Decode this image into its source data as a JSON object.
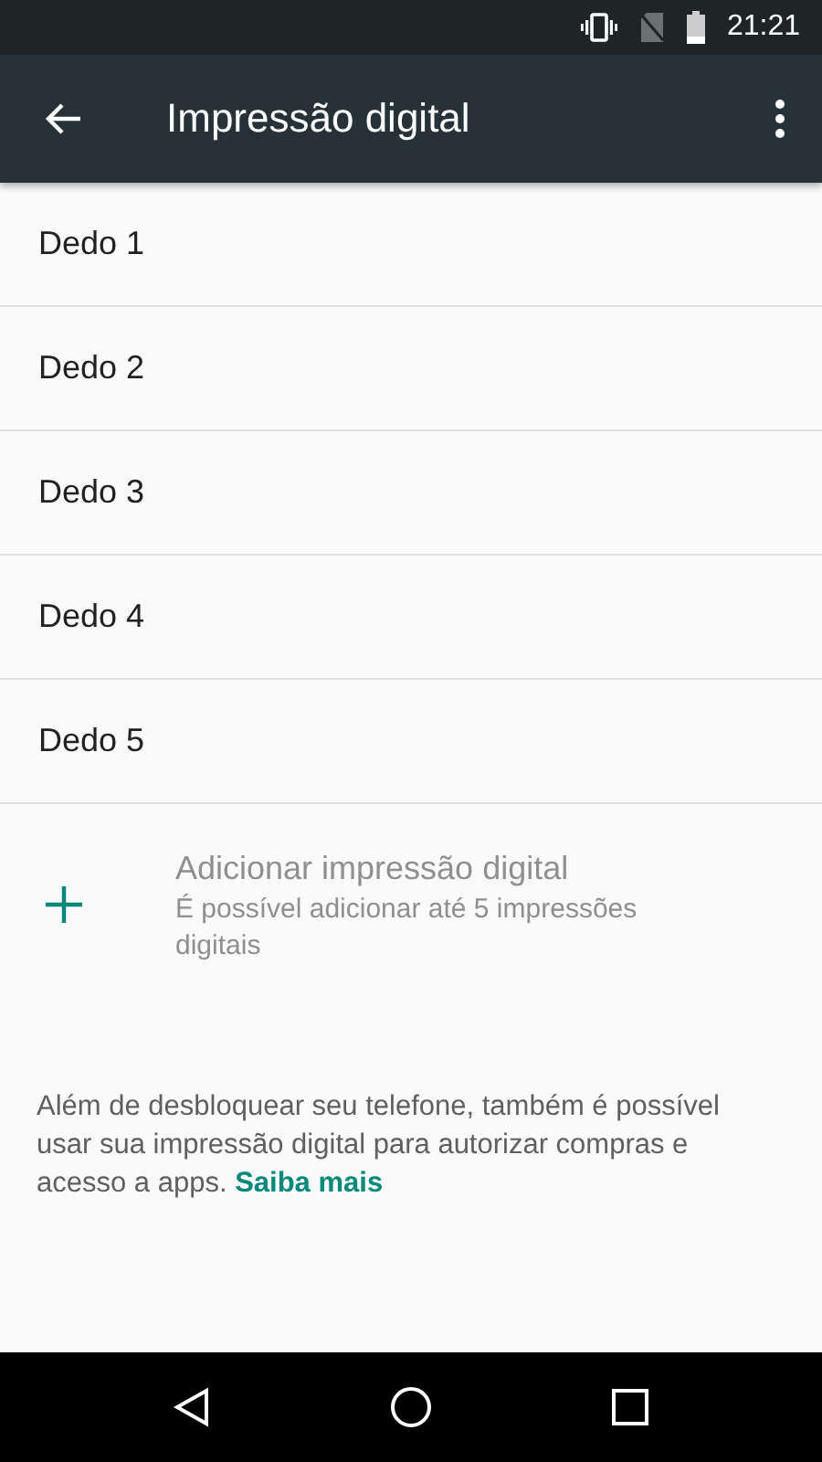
{
  "status_bar": {
    "time": "21:21"
  },
  "app_bar": {
    "title": "Impressão digital"
  },
  "fingerprints": [
    {
      "label": "Dedo 1"
    },
    {
      "label": "Dedo 2"
    },
    {
      "label": "Dedo 3"
    },
    {
      "label": "Dedo 4"
    },
    {
      "label": "Dedo 5"
    }
  ],
  "add_item": {
    "title": "Adicionar impressão digital",
    "summary": "É possível adicionar até 5 impressões digitais",
    "disabled": true
  },
  "info": {
    "text": "Além de desbloquear seu telefone, também é possível usar sua impressão digital para autorizar compras e acesso a apps.",
    "link": "Saiba mais"
  }
}
